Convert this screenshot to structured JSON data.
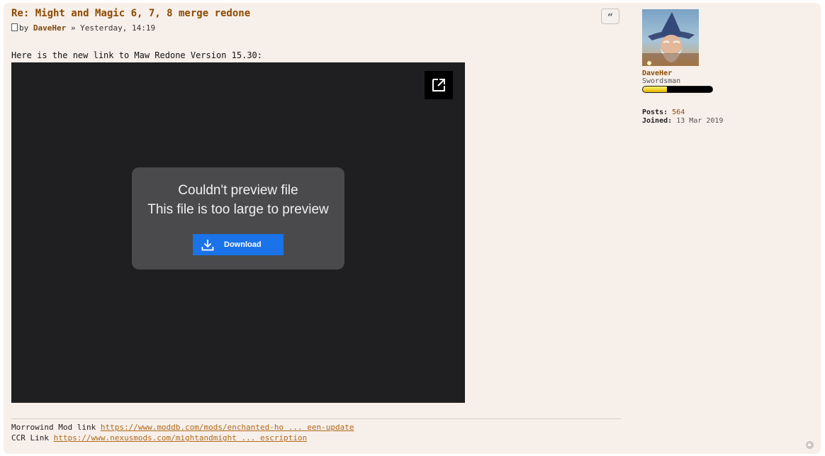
{
  "post": {
    "title": "Re: Might and Magic 6, 7, 8 merge redone",
    "meta": {
      "by": "by",
      "author": "DaveHer",
      "separator": "»",
      "time": "Yesterday, 14:19"
    },
    "quote_label": "“",
    "intro": "Here is the new link to Maw Redone Version 15.30:",
    "preview": {
      "line1": "Couldn't preview file",
      "line2": "This file is too large to preview",
      "download_label": "Download"
    },
    "signature": {
      "line1_label": "Morrowind Mod link",
      "line1_link": "https://www.moddb.com/mods/enchanted-ho ... een-update",
      "line2_label": "CCR Link",
      "line2_link": "https://www.nexusmods.com/mightandmight ... escription"
    }
  },
  "profile": {
    "username": "DaveHer",
    "rank": "Swordsman",
    "rank_progress": 0.35,
    "posts_label": "Posts:",
    "posts_value": "564",
    "joined_label": "Joined:",
    "joined_value": "13 Mar 2019"
  },
  "icons": {
    "quote": "quote-icon",
    "popout": "open-in-new-icon",
    "download": "download-icon",
    "back_to_top": "arrow-up-icon"
  }
}
